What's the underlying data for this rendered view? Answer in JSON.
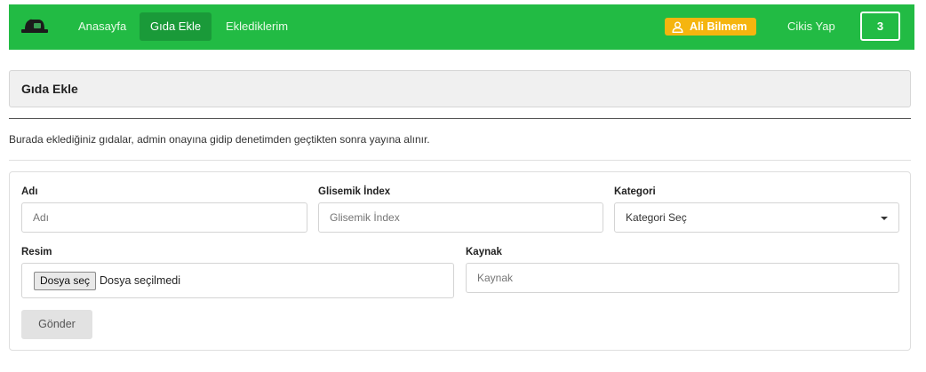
{
  "nav": {
    "links": [
      {
        "label": "Anasayfa"
      },
      {
        "label": "Gıda Ekle"
      },
      {
        "label": "Eklediklerim"
      }
    ],
    "user_name": "Ali Bilmem",
    "logout_label": "Cikis Yap",
    "count": "3",
    "brand_color": "#22bb44",
    "user_badge_color": "#f5b50f"
  },
  "page": {
    "title": "Gıda Ekle",
    "info": "Burada eklediğiniz gıdalar, admin onayına gidip denetimden geçtikten sonra yayına alınır."
  },
  "form": {
    "name": {
      "label": "Adı",
      "placeholder": "Adı"
    },
    "glycemic": {
      "label": "Glisemik İndex",
      "placeholder": "Glisemik İndex"
    },
    "category": {
      "label": "Kategori",
      "selected": "Kategori Seç"
    },
    "image": {
      "label": "Resim",
      "button": "Dosya seç",
      "status": "Dosya seçilmedi"
    },
    "source": {
      "label": "Kaynak",
      "placeholder": "Kaynak"
    },
    "submit": "Gönder"
  },
  "icons": {
    "logo": "bread-basket-icon",
    "user": "user-icon",
    "caret": "caret-down-icon"
  }
}
